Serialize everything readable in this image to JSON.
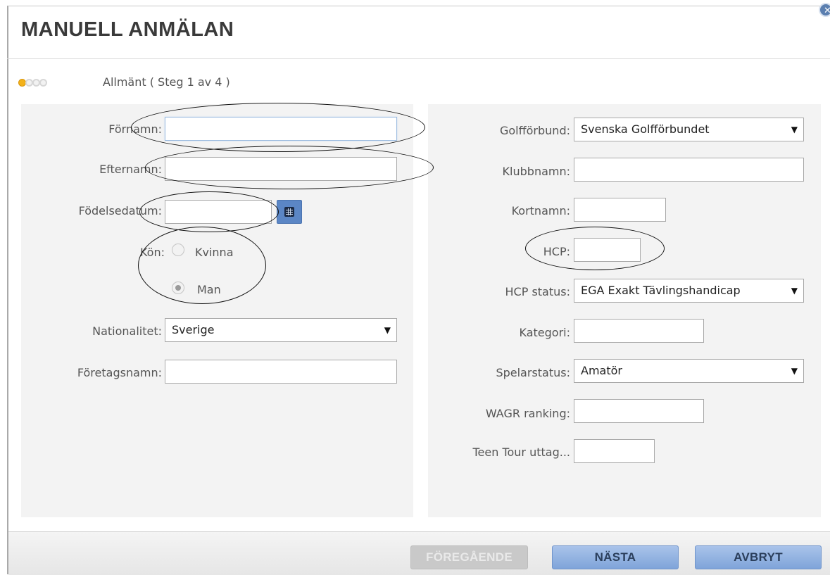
{
  "dialog": {
    "title": "MANUELL ANMÄLAN",
    "close_icon": "close-icon",
    "step_label": "Allmänt ( Steg 1 av 4 )",
    "steps": {
      "total": 4,
      "current": 1
    }
  },
  "left": {
    "fornamn": {
      "label": "Förnamn:",
      "value": ""
    },
    "efternamn": {
      "label": "Efternamn:",
      "value": ""
    },
    "fodelsedatum": {
      "label": "Födelsedatum:",
      "value": "",
      "icon": "calendar-icon"
    },
    "kon": {
      "label": "Kön:",
      "options": [
        "Kvinna",
        "Man"
      ],
      "selected": "Man"
    },
    "nationalitet": {
      "label": "Nationalitet:",
      "value": "Sverige"
    },
    "foretagsnamn": {
      "label": "Företagsnamn:",
      "value": ""
    }
  },
  "right": {
    "golfforbund": {
      "label": "Golfförbund:",
      "value": "Svenska Golfförbundet"
    },
    "klubbnamn": {
      "label": "Klubbnamn:",
      "value": ""
    },
    "kortnamn": {
      "label": "Kortnamn:",
      "value": ""
    },
    "hcp": {
      "label": "HCP:",
      "value": ""
    },
    "hcp_status": {
      "label": "HCP status:",
      "value": "EGA Exakt Tävlingshandicap"
    },
    "kategori": {
      "label": "Kategori:",
      "value": ""
    },
    "spelarstatus": {
      "label": "Spelarstatus:",
      "value": "Amatör"
    },
    "wagr": {
      "label": "WAGR ranking:",
      "value": ""
    },
    "teen_tour": {
      "label": "Teen Tour uttag...",
      "value": ""
    }
  },
  "footer": {
    "previous": "FÖREGÅENDE",
    "next": "NÄSTA",
    "cancel": "AVBRYT"
  },
  "colors": {
    "primary_button": "#7fa4d9",
    "active_step": "#f3b21b",
    "panel_bg": "#f3f3f3"
  }
}
